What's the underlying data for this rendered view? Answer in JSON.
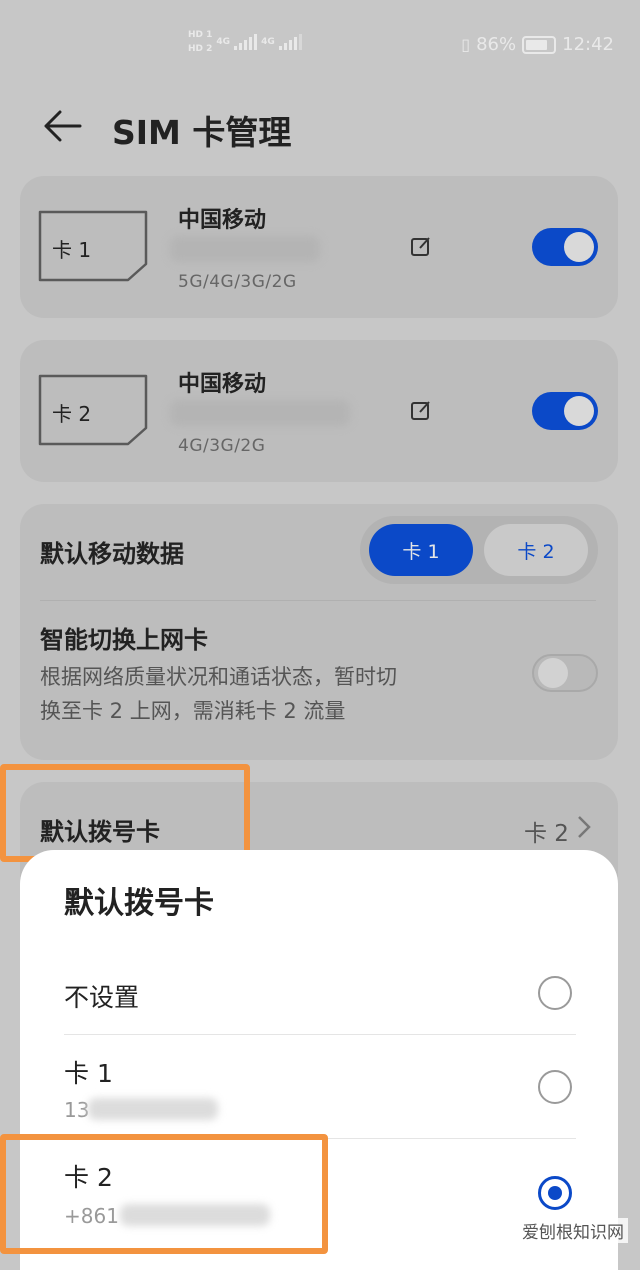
{
  "status_bar": {
    "sim1_badge": "HD 1",
    "sim2_badge": "HD 2",
    "net1": "4G",
    "net2": "4G",
    "battery": "86%",
    "time": "12:42"
  },
  "header": {
    "title": "SIM 卡管理",
    "back_icon": "arrow-left-icon"
  },
  "sim_cards": [
    {
      "label": "卡 1",
      "carrier": "中国移动",
      "network": "5G/4G/3G/2G",
      "enabled": true
    },
    {
      "label": "卡 2",
      "carrier": "中国移动",
      "network": "4G/3G/2G",
      "enabled": true
    }
  ],
  "data_settings": {
    "default_data_label": "默认移动数据",
    "seg_options": [
      "卡 1",
      "卡 2"
    ],
    "seg_selected": "卡 1",
    "smart_switch_title": "智能切换上网卡",
    "smart_switch_desc_line1": "根据网络质量状况和通话状态，暂时切",
    "smart_switch_desc_line2": "换至卡 2 上网，需消耗卡 2 流量",
    "smart_switch_enabled": false
  },
  "dial_row": {
    "label": "默认拨号卡",
    "value": "卡 2"
  },
  "sheet": {
    "title": "默认拨号卡",
    "options": [
      {
        "label": "不设置",
        "sub": "",
        "selected": false
      },
      {
        "label": "卡 1",
        "sub": "13",
        "selected": false
      },
      {
        "label": "卡 2",
        "sub": "+861",
        "selected": true
      }
    ]
  },
  "watermark": "爱刨根知识网",
  "colors": {
    "accent": "#0b49c8",
    "highlight": "#f3933f"
  }
}
